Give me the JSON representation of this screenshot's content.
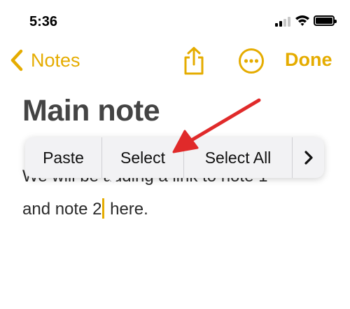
{
  "status_bar": {
    "time": "5:36"
  },
  "nav": {
    "back_label": "Notes",
    "done_label": "Done"
  },
  "note": {
    "title": "Main note",
    "line1": "We will be adding a link to note 1",
    "line2_before_cursor": "and note 2",
    "line2_after_cursor": " here."
  },
  "edit_menu": {
    "paste": "Paste",
    "select": "Select",
    "select_all": "Select All"
  },
  "colors": {
    "accent": "#e5ac00",
    "annotation": "#e02a2a"
  },
  "icons": [
    "chevron-left-icon",
    "share-icon",
    "more-options-icon",
    "chevron-right-icon",
    "signal-icon",
    "wifi-icon",
    "battery-icon"
  ]
}
